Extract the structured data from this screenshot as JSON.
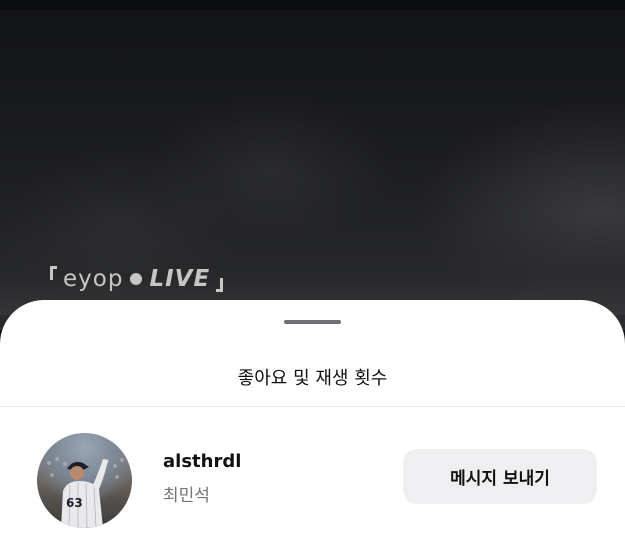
{
  "video": {
    "watermark_prefix": "eyop",
    "watermark_live": "LIVE"
  },
  "sheet": {
    "title": "좋아요 및 재생 횟수"
  },
  "users": [
    {
      "username": "alsthrdl",
      "display_name": "최민석",
      "jersey_number": "63",
      "action_label": "메시지 보내기"
    }
  ],
  "colors": {
    "sheet_bg": "#ffffff",
    "button_bg": "#efeff1",
    "secondary_text": "#757575"
  }
}
